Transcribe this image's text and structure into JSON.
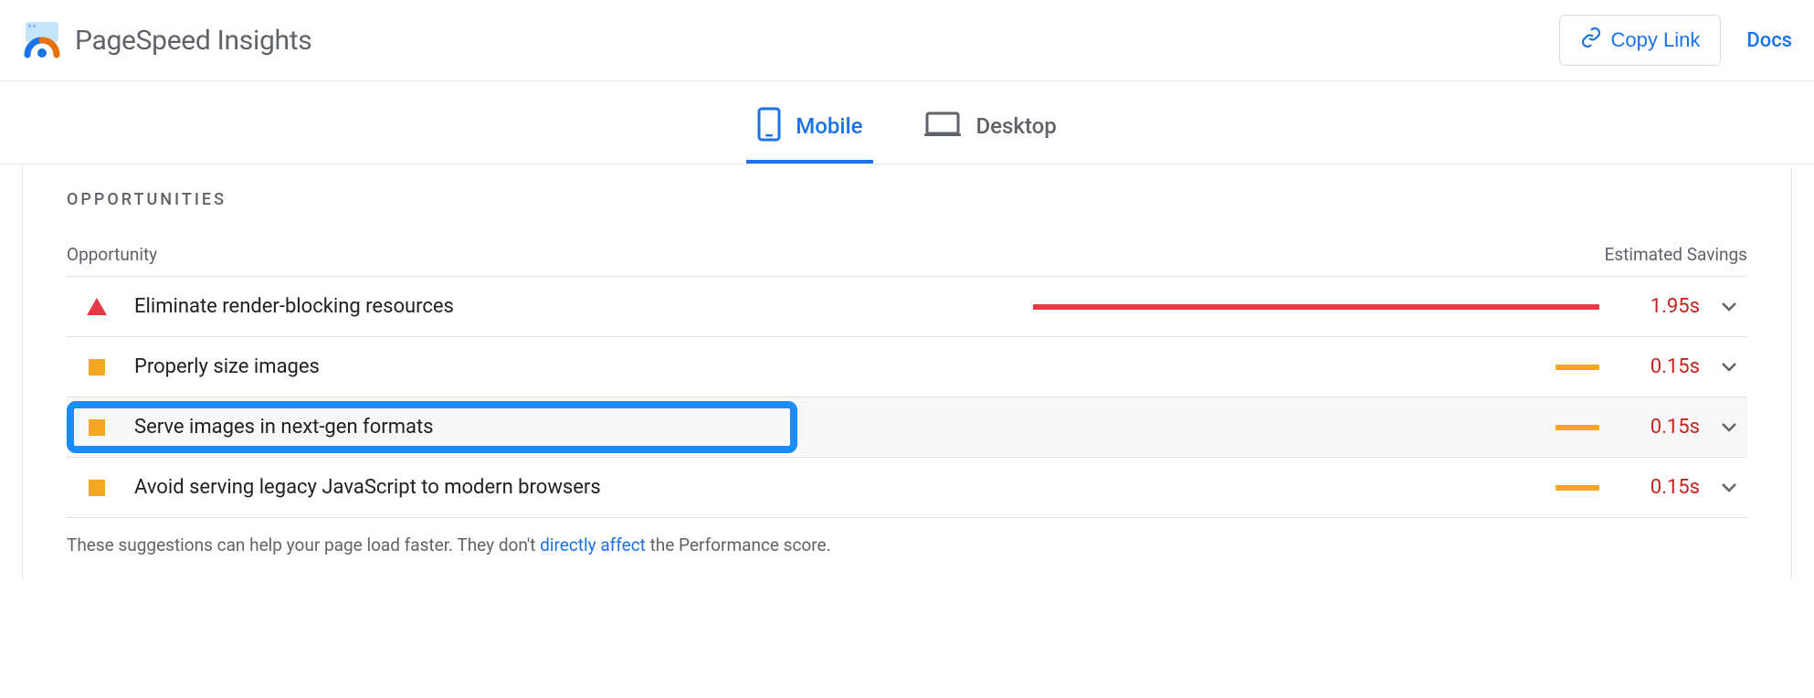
{
  "header": {
    "title": "PageSpeed Insights",
    "copy_link_label": "Copy Link",
    "docs_label": "Docs"
  },
  "tabs": {
    "mobile": "Mobile",
    "desktop": "Desktop"
  },
  "opportunities": {
    "section_title": "OPPORTUNITIES",
    "column_opportunity": "Opportunity",
    "column_savings": "Estimated Savings",
    "rows": [
      {
        "label": "Eliminate render-blocking resources",
        "savings": "1.95s",
        "severity": "red"
      },
      {
        "label": "Properly size images",
        "savings": "0.15s",
        "severity": "orange"
      },
      {
        "label": "Serve images in next-gen formats",
        "savings": "0.15s",
        "severity": "orange"
      },
      {
        "label": "Avoid serving legacy JavaScript to modern browsers",
        "savings": "0.15s",
        "severity": "orange"
      }
    ],
    "footer_prefix": "These suggestions can help your page load faster. They don't ",
    "footer_link": "directly affect",
    "footer_suffix": " the Performance score."
  }
}
